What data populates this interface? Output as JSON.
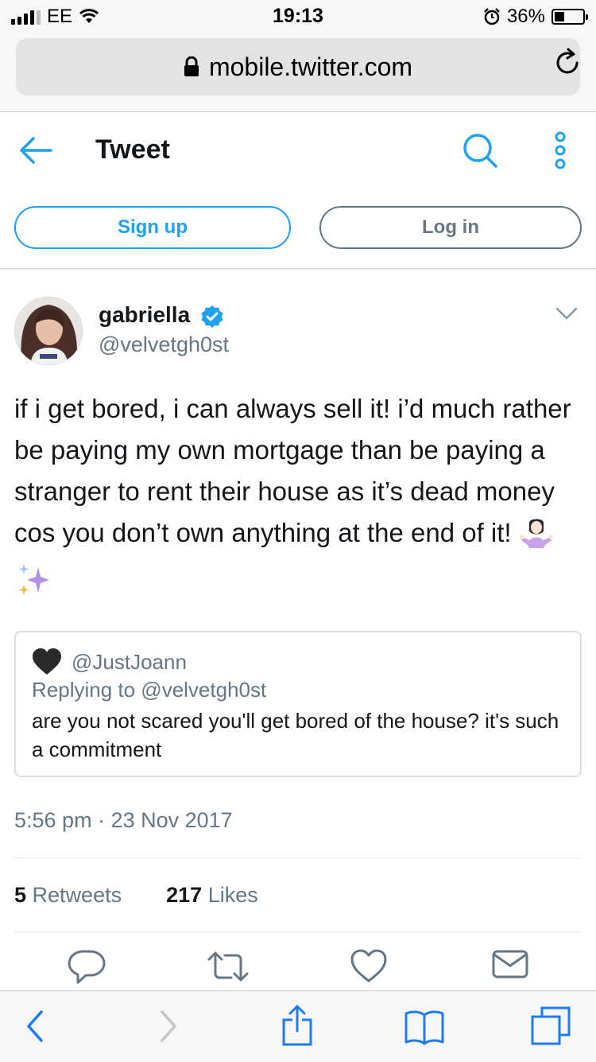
{
  "status": {
    "carrier": "EE",
    "time": "19:13",
    "battery": "36%",
    "battery_level": 0.36
  },
  "browser": {
    "url": "mobile.twitter.com"
  },
  "header": {
    "title": "Tweet",
    "signup_label": "Sign up",
    "login_label": "Log in"
  },
  "tweet": {
    "name": "gabriella",
    "handle": "@velvetgh0st",
    "text": "if i get bored, i can always sell it! i’d much rather be paying my own mortgage than be paying a stranger to rent their house as it’s dead money cos you don’t own anything at the end of it!",
    "quote": {
      "handle": "@JustJoann",
      "replying_to": "Replying to @velvetgh0st",
      "text": "are you not scared you'll get bored of the house? it's such a commitment"
    },
    "timestamp": "5:56 pm · 23 Nov 2017",
    "retweets_count": "5",
    "retweets_label": "Retweets",
    "likes_count": "217",
    "likes_label": "Likes"
  },
  "icons": {
    "status": [
      "signal-icon",
      "wifi-icon",
      "alarm-icon",
      "battery-icon"
    ],
    "browser": [
      "lock-icon",
      "reload-icon"
    ],
    "header": [
      "back-arrow-icon",
      "search-icon",
      "more-icon"
    ],
    "tweet": [
      "verified-icon",
      "chevron-down-icon",
      "person-shrugging-emoji",
      "sparkles-emoji",
      "heart-icon"
    ],
    "actions": [
      "reply-icon",
      "retweet-icon",
      "like-icon",
      "message-icon"
    ],
    "toolbar": [
      "back-icon",
      "forward-icon",
      "share-icon",
      "bookmarks-icon",
      "tabs-icon"
    ]
  },
  "colors": {
    "accent": "#1da1f2",
    "secondary_text": "#657786",
    "primary_text": "#14171a",
    "ios_blue": "#1d7cf5"
  }
}
